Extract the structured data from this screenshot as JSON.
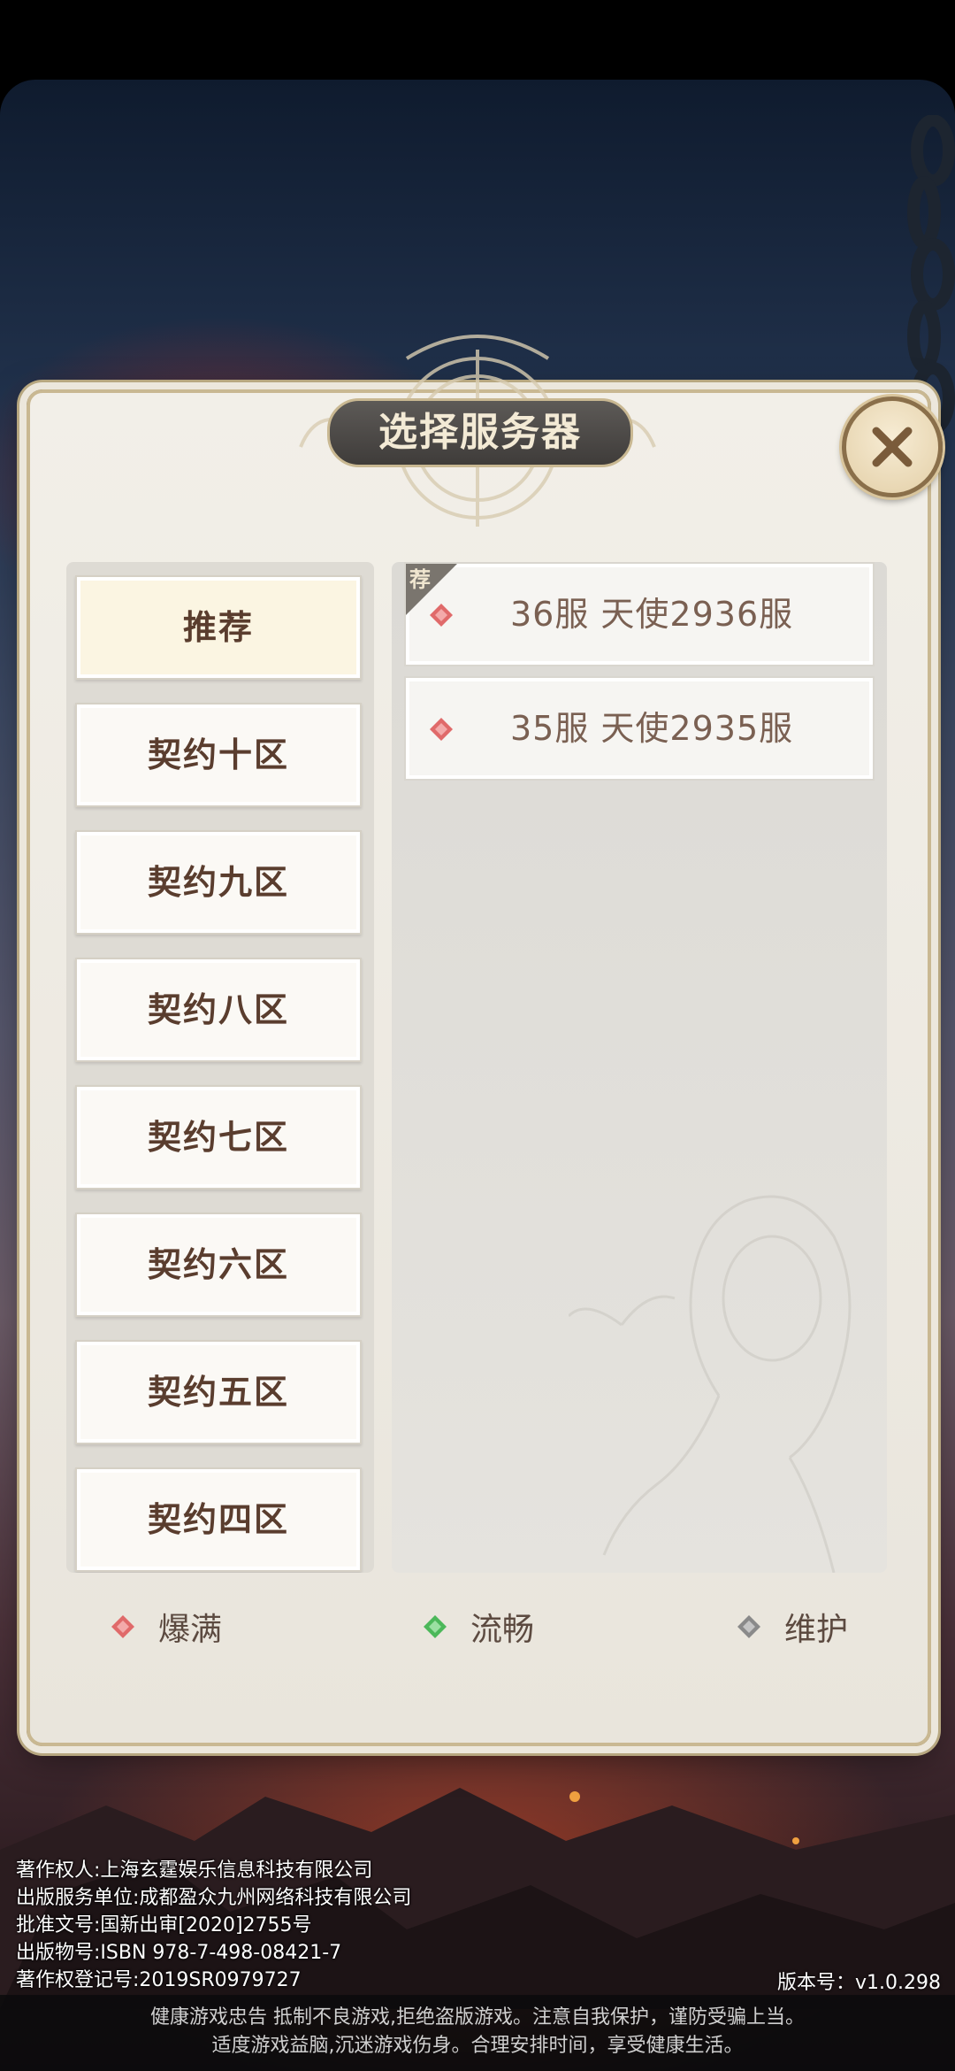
{
  "dialog": {
    "title": "选择服务器"
  },
  "zones": [
    {
      "label": "推荐",
      "selected": true
    },
    {
      "label": "契约十区",
      "selected": false
    },
    {
      "label": "契约九区",
      "selected": false
    },
    {
      "label": "契约八区",
      "selected": false
    },
    {
      "label": "契约七区",
      "selected": false
    },
    {
      "label": "契约六区",
      "selected": false
    },
    {
      "label": "契约五区",
      "selected": false
    },
    {
      "label": "契约四区",
      "selected": false
    }
  ],
  "servers": [
    {
      "label": "36服   天使2936服",
      "status": "full",
      "badge": "荐"
    },
    {
      "label": "35服   天使2935服",
      "status": "full",
      "badge": ""
    }
  ],
  "legend": {
    "full": "爆满",
    "smooth": "流畅",
    "maintenance": "维护"
  },
  "colors": {
    "full": "#e06a6a",
    "smooth": "#4cb85a",
    "maintenance": "#8a8a8a",
    "accent_gold": "#c9b892",
    "zone_text": "#5a3d2e"
  },
  "credits": {
    "copyright_owner": "著作权人:上海玄霆娱乐信息科技有限公司",
    "publisher": "出版服务单位:成都盈众九州网络科技有限公司",
    "approval": "批准文号:国新出审[2020]2755号",
    "isbn": "出版物号:ISBN 978-7-498-08421-7",
    "registration": "著作权登记号:2019SR0979727",
    "version": "版本号：v1.0.298"
  },
  "health_notice": {
    "line1": "健康游戏忠告   抵制不良游戏,拒绝盗版游戏。注意自我保护，谨防受骗上当。",
    "line2": "适度游戏益脑,沉迷游戏伤身。合理安排时间，享受健康生活。"
  }
}
